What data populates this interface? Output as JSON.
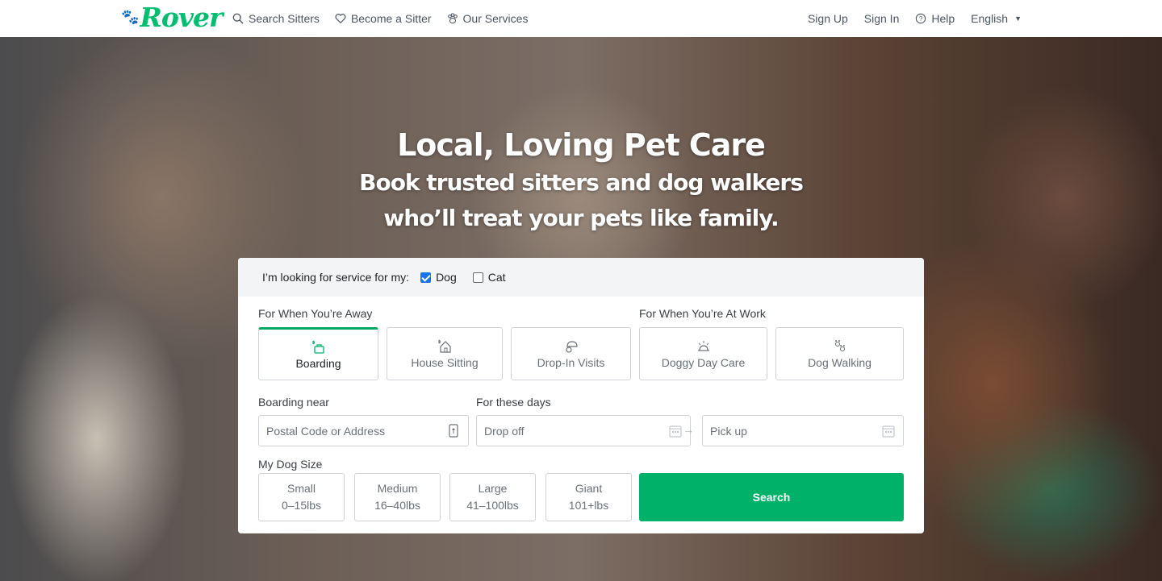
{
  "nav": {
    "logo": "Rover",
    "links": [
      {
        "label": "Search Sitters",
        "icon": "search-icon"
      },
      {
        "label": "Become a Sitter",
        "icon": "heart-icon"
      },
      {
        "label": "Our Services",
        "icon": "paw-icon"
      }
    ],
    "right": [
      {
        "label": "Sign Up"
      },
      {
        "label": "Sign In"
      },
      {
        "label": "Help",
        "icon": "help-circle-icon"
      },
      {
        "label": "English",
        "icon": "caret-down-icon"
      }
    ]
  },
  "hero": {
    "title": "Local, Loving Pet Care",
    "subtitle_line1": "Book trusted sitters and dog walkers",
    "subtitle_line2": "who’ll treat your pets like family."
  },
  "form": {
    "pets_prompt": "I’m looking for service for my:",
    "pets": [
      {
        "label": "Dog",
        "checked": true
      },
      {
        "label": "Cat",
        "checked": false
      }
    ],
    "away_heading": "For When You’re Away",
    "work_heading": "For When You’re At Work",
    "services": [
      {
        "label": "Boarding",
        "icon": "boarding-icon",
        "selected": true
      },
      {
        "label": "House Sitting",
        "icon": "house-sitting-icon",
        "selected": false
      },
      {
        "label": "Drop-In Visits",
        "icon": "drop-in-icon",
        "selected": false
      },
      {
        "label": "Doggy Day Care",
        "icon": "day-care-icon",
        "selected": false
      },
      {
        "label": "Dog Walking",
        "icon": "dog-walking-icon",
        "selected": false
      }
    ],
    "location_label": "Boarding near",
    "location_placeholder": "Postal Code or Address",
    "dates_label": "For these days",
    "dropoff_placeholder": "Drop off",
    "pickup_placeholder": "Pick up",
    "size_label": "My Dog Size",
    "sizes": [
      {
        "name": "Small",
        "range": "0–15lbs"
      },
      {
        "name": "Medium",
        "range": "16–40lbs"
      },
      {
        "name": "Large",
        "range": "41–100lbs"
      },
      {
        "name": "Giant",
        "range": "101+lbs"
      }
    ],
    "search_label": "Search"
  },
  "colors": {
    "brand": "#00bd70",
    "button": "#00b16a",
    "checkbox": "#1a73e8"
  }
}
